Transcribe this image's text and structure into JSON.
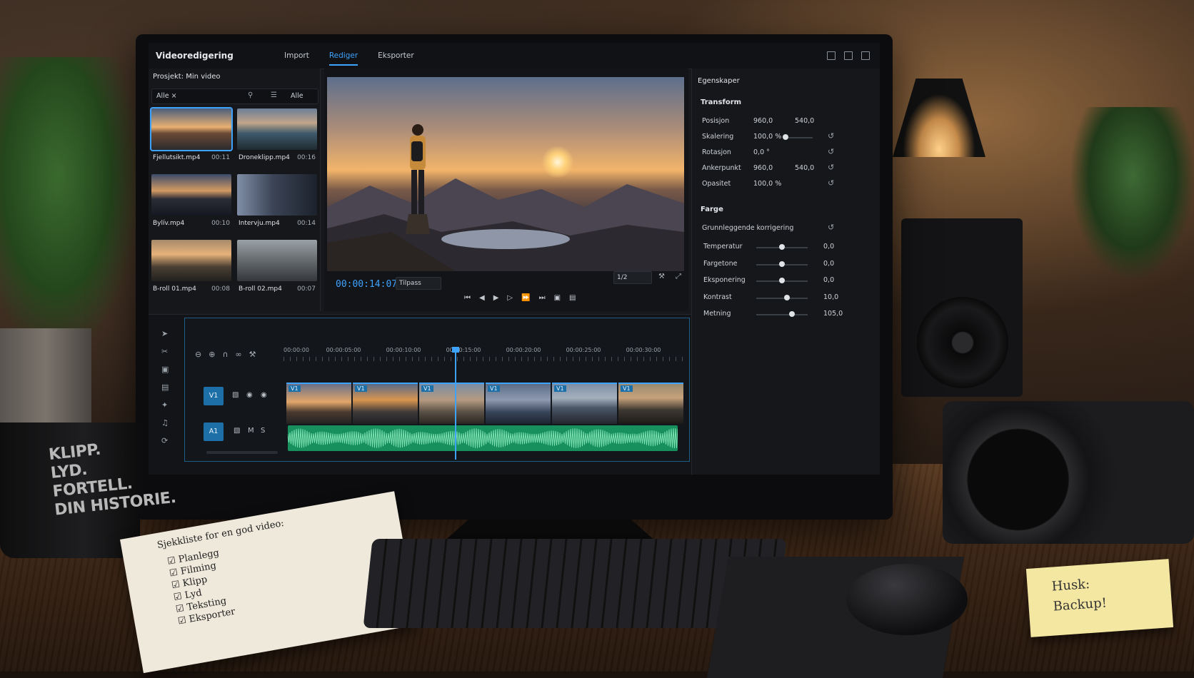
{
  "app": {
    "title": "Videoredigering",
    "tabs": [
      {
        "label": "Import",
        "active": false
      },
      {
        "label": "Rediger",
        "active": true
      },
      {
        "label": "Eksporter",
        "active": false
      }
    ],
    "accent_color": "#3ea3ff"
  },
  "media": {
    "project": "Prosjekt: Min video",
    "filter_left": "Alle ×",
    "filter_right": "Alle",
    "clips": [
      {
        "name": "Fjellutsikt.mp4",
        "duration": "00:11",
        "selected": true
      },
      {
        "name": "Droneklipp.mp4",
        "duration": "00:16"
      },
      {
        "name": "Bylív.mp4",
        "duration": "00:10"
      },
      {
        "name": "Intervju.mp4",
        "duration": "00:14"
      },
      {
        "name": "B-roll 01.mp4",
        "duration": "00:08"
      },
      {
        "name": "B-roll 02.mp4",
        "duration": "00:07"
      }
    ]
  },
  "preview": {
    "timecode": "00:00:14:07",
    "fit": "Tilpass",
    "quality": "1/2"
  },
  "properties": {
    "title": "Egenskaper",
    "transform": {
      "heading": "Transform",
      "position": {
        "label": "Posisjon",
        "x": "960,0",
        "y": "540,0"
      },
      "scale": {
        "label": "Skalering",
        "value": "100,0 %",
        "level": 0.05
      },
      "rotation": {
        "label": "Rotasjon",
        "value": "0,0 °"
      },
      "anchor": {
        "label": "Ankerpunkt",
        "x": "960,0",
        "y": "540,0"
      },
      "opacity": {
        "label": "Opasitet",
        "value": "100,0 %"
      }
    },
    "color": {
      "heading": "Farge",
      "basic": "Grunnleggende korrigering",
      "sliders": [
        {
          "label": "Temperatur",
          "value": "0,0",
          "level": 0.5
        },
        {
          "label": "Fargetone",
          "value": "0,0",
          "level": 0.5
        },
        {
          "label": "Eksponering",
          "value": "0,0",
          "level": 0.5
        },
        {
          "label": "Kontrast",
          "value": "10,0",
          "level": 0.6
        },
        {
          "label": "Metning",
          "value": "105,0",
          "level": 0.7
        }
      ]
    }
  },
  "timeline": {
    "ruler": [
      "00:00:00",
      "00:00:05:00",
      "00:00:10:00",
      "00:00:15:00",
      "00:00:20:00",
      "00:00:25:00",
      "00:00:30:00"
    ],
    "video_track": {
      "name": "V1",
      "clip_label": "V1"
    },
    "audio_track": {
      "name": "A1",
      "mute": "M",
      "solo": "S"
    },
    "playhead_time": "00:00:14:07"
  },
  "desk": {
    "mug_lines": [
      "KLIPP.",
      "LYD.",
      "FORTELL.",
      "DIN HISTORIE."
    ],
    "notebook_title": "Sjekkliste for en god video:",
    "checklist": [
      "Planlegg",
      "Filming",
      "Klipp",
      "Lyd",
      "Teksting",
      "Eksporter"
    ],
    "sticky_lines": [
      "Husk:",
      "Backup!"
    ]
  }
}
